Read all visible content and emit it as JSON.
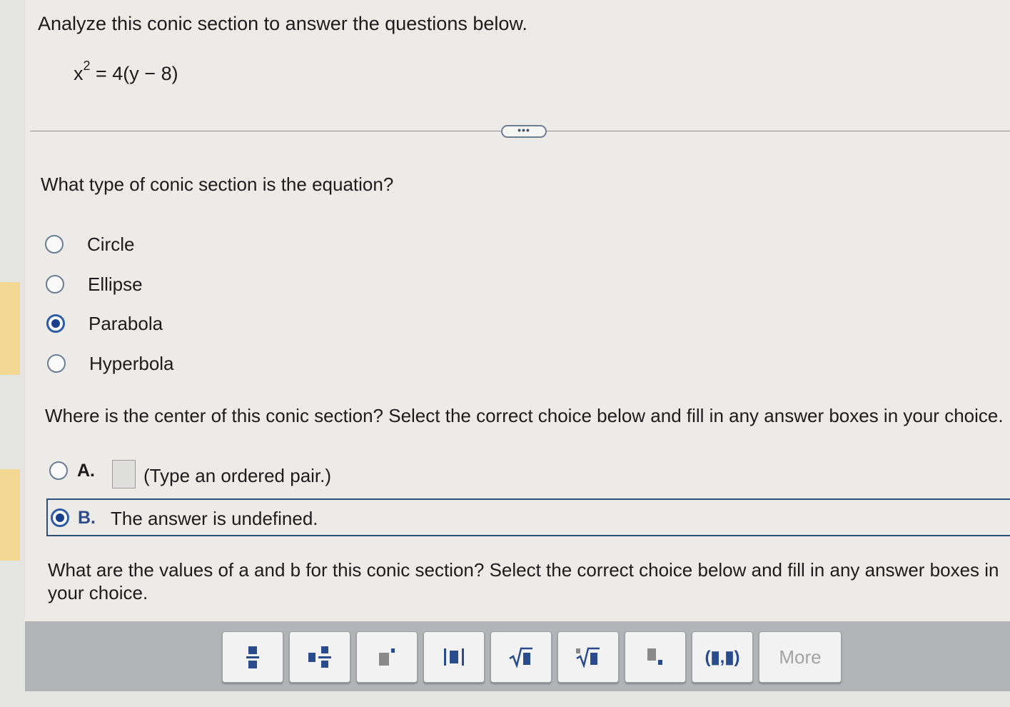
{
  "prompt": "Analyze this conic section to answer the questions below.",
  "equation": {
    "base": "x",
    "exponent": "2",
    "rest": " = 4(y − 8)"
  },
  "expand_label": "•••",
  "q1": {
    "text": "What type of conic section is the equation?",
    "options": [
      "Circle",
      "Ellipse",
      "Parabola",
      "Hyperbola"
    ],
    "selected": "Parabola"
  },
  "q2": {
    "text": "Where is the center of this conic section? Select the correct choice below and fill in any answer boxes in your choice.",
    "choice_a_letter": "A.",
    "choice_a_text": "(Type an ordered pair.)",
    "choice_b_letter": "B.",
    "choice_b_text": "The answer is undefined.",
    "selected": "B"
  },
  "q3": {
    "text": "What are the values of a and b for this conic section? Select the correct choice below and fill in any answer boxes in your choice."
  },
  "toolbar": {
    "buttons": [
      "fraction-icon",
      "mixed-number-icon",
      "exponent-icon",
      "absolute-value-icon",
      "square-root-icon",
      "nth-root-icon",
      "subscript-icon",
      "ordered-pair-icon"
    ],
    "ordered_pair_label": "(▮,▮)",
    "more_label": "More"
  },
  "colors": {
    "accent": "#2f5aa5",
    "toolbar": "#b2b4b8",
    "highlight": "#f2d792"
  }
}
